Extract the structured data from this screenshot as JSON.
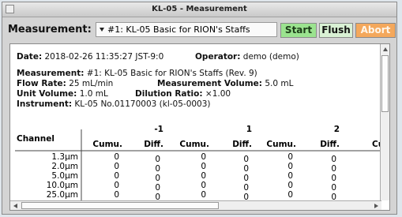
{
  "window": {
    "title": "KL-05 - Measurement"
  },
  "toolbar": {
    "measurement_label": "Measurement:",
    "measurement_select": "#1: KL-05 Basic for RION's Staffs",
    "start_label": "Start",
    "flush_label": "Flush",
    "abort_label": "Abort"
  },
  "info": {
    "date_label": "Date:",
    "date_value": "2018-02-26 11:35:27 JST-9:0",
    "operator_label": "Operator:",
    "operator_value": "demo (demo)",
    "measurement_label": "Measurement:",
    "measurement_value": "#1: KL-05 Basic for RION's Staffs (Rev. 9)",
    "flow_rate_label": "Flow Rate:",
    "flow_rate_value": "25 mL/min",
    "measurement_volume_label": "Measurement Volume:",
    "measurement_volume_value": "5.0 mL",
    "unit_volume_label": "Unit Volume:",
    "unit_volume_value": "1.0 mL",
    "dilution_ratio_label": "Dilution Ratio:",
    "dilution_ratio_value": "×1.00",
    "instrument_label": "Instrument:",
    "instrument_value": "KL-05 No.01170003 (kl-05-0003)"
  },
  "table": {
    "channel_header": "Channel",
    "groups": [
      {
        "number": "-1",
        "cumu": "Cumu.",
        "diff": "Diff."
      },
      {
        "number": "1",
        "cumu": "Cumu.",
        "diff": "Diff."
      },
      {
        "number": "2",
        "cumu": "Cumu.",
        "diff": "Diff."
      }
    ],
    "partial_header": "Cu",
    "channels": [
      "1.3µm",
      "2.0µm",
      "5.0µm",
      "10.0µm",
      "25.0µm"
    ],
    "rows": [
      [
        "0",
        "0",
        "0",
        "0",
        "0",
        "0"
      ],
      [
        "0",
        "0",
        "0",
        "0",
        "0",
        "0"
      ],
      [
        "0",
        "0",
        "0",
        "0",
        "0",
        "0"
      ],
      [
        "0",
        "0",
        "0",
        "0",
        "0",
        "0"
      ],
      [
        "0",
        "0",
        "0",
        "0",
        "0",
        "0"
      ]
    ]
  }
}
